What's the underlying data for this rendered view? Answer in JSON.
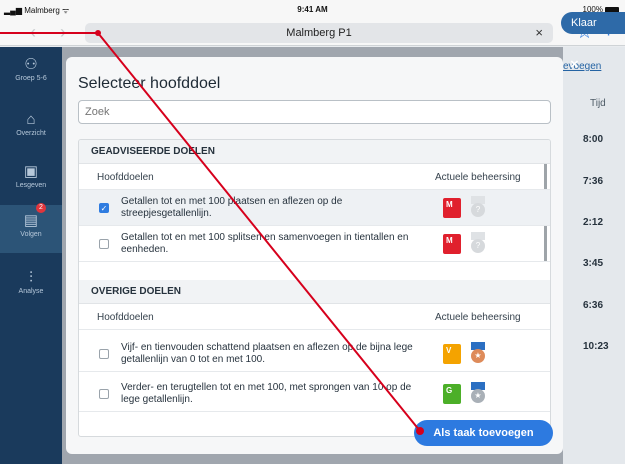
{
  "status": {
    "carrier": "Malmberg",
    "time": "9:41 AM",
    "battery": "100%"
  },
  "browser": {
    "url_title": "Malmberg P1",
    "close": "×",
    "bookmark": "☆",
    "add": "+"
  },
  "sidebar": {
    "items": [
      {
        "label": "Groep 5-6",
        "icon": "group-icon"
      },
      {
        "label": "Overzicht",
        "icon": "home-icon"
      },
      {
        "label": "Lesgeven",
        "icon": "teach-icon"
      },
      {
        "label": "Volgen",
        "icon": "tracking-icon",
        "badge": "2"
      },
      {
        "label": "Analyse",
        "icon": "analysis-icon"
      }
    ]
  },
  "background": {
    "klaar_label": "Klaar",
    "toevoegen_label": "evoegen",
    "tijd_header": "Tijd",
    "tijd_values": [
      "8:00",
      "7:36",
      "2:12",
      "3:45",
      "6:36",
      "10:23"
    ]
  },
  "modal": {
    "title": "Selecteer hoofddoel",
    "search_placeholder": "Zoek",
    "sections": [
      {
        "heading": "GEADVISEERDE DOELEN",
        "col_left": "Hoofddoelen",
        "col_right": "Actuele beheersing",
        "rows": [
          {
            "text": "Getallen tot en met 100 plaatsen en aflezen op de streepjesgetallenlijn.",
            "checked": true,
            "mastery": "M",
            "mastery_color": "#e0202d",
            "medal": "?",
            "medal_color": "#d6d9dc"
          },
          {
            "text": "Getallen tot en met 100 splitsen en samenvoegen in tientallen en eenheden.",
            "checked": false,
            "mastery": "M",
            "mastery_color": "#e0202d",
            "medal": "?",
            "medal_color": "#d6d9dc"
          }
        ]
      },
      {
        "heading": "OVERIGE DOELEN",
        "col_left": "Hoofddoelen",
        "col_right": "Actuele beheersing",
        "rows": [
          {
            "text": "Vijf- en tienvouden schattend plaatsen en aflezen op de bijna lege getallenlijn van 0 tot en met 100.",
            "checked": false,
            "mastery": "V",
            "mastery_color": "#f4a300",
            "medal": "★",
            "medal_color": "#de8b5a"
          },
          {
            "text": "Verder- en terugtellen tot en met 100, met sprongen van 10 op de lege getallenlijn.",
            "checked": false,
            "mastery": "G",
            "mastery_color": "#4caf28",
            "medal": "★",
            "medal_color": "#a9b0b7"
          }
        ]
      }
    ],
    "add_button": "Als taak toevoegen",
    "close_icon": "×"
  },
  "annotation_color": "#d6001c"
}
